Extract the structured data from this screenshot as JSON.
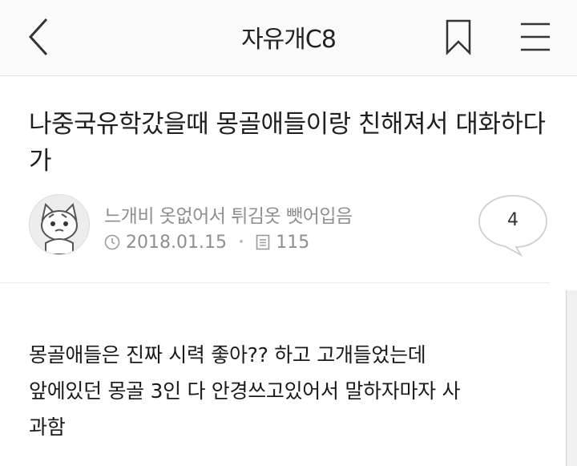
{
  "header": {
    "board_title": "자유개C8"
  },
  "post": {
    "title": "나중국유학갔을때 몽골애들이랑 친해져서 대화하다가",
    "author": "느개비 옷없어서 튀김옷 뺏어입음",
    "date": "2018.01.15",
    "views": "115",
    "comment_count": "4",
    "body_lines": [
      "몽골애들은 진짜 시력 좋아?? 하고 고개들었는데",
      "앞에있던 몽골 3인 다 안경쓰고있어서 말하자마자 사",
      "과함"
    ]
  },
  "icons": {
    "back": "chevron-left-icon",
    "bookmark": "bookmark-icon",
    "menu": "hamburger-menu-icon",
    "clock": "clock-icon",
    "views": "document-icon",
    "comments": "speech-bubble-icon"
  }
}
